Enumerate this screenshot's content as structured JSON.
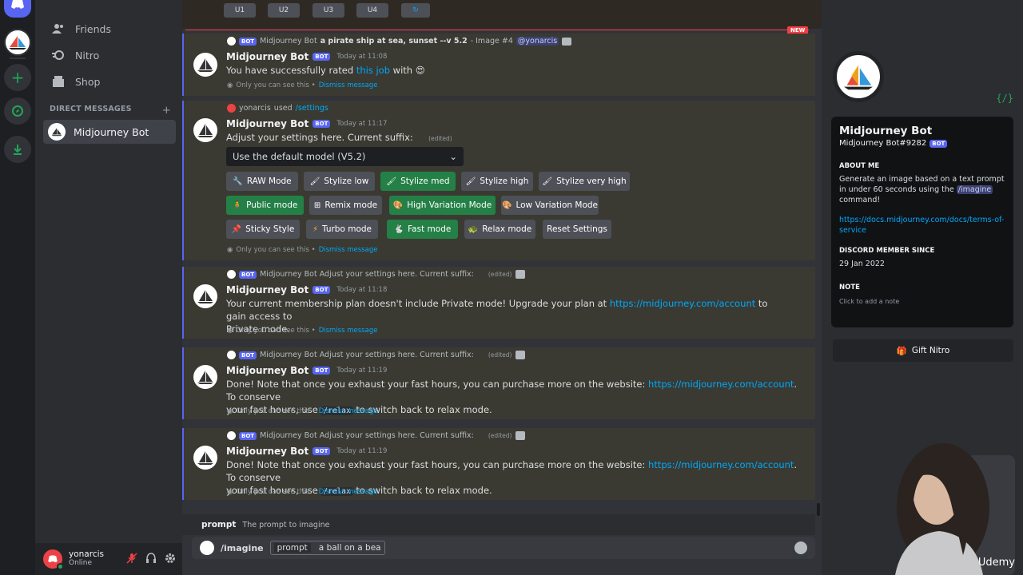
{
  "sidebar": {
    "nav": [
      {
        "label": "Friends",
        "icon": "friends-icon"
      },
      {
        "label": "Nitro",
        "icon": "nitro-icon"
      },
      {
        "label": "Shop",
        "icon": "shop-icon"
      }
    ],
    "dm_header": "DIRECT MESSAGES",
    "dm_items": [
      {
        "label": "Midjourney Bot"
      }
    ]
  },
  "user": {
    "name": "yonarcis",
    "status": "Online"
  },
  "top_buttons": [
    "U1",
    "U2",
    "U3",
    "U4"
  ],
  "new_badge": "NEW",
  "bot_tag": "BOT",
  "messages": [
    {
      "reply_prefix": "Midjourney Bot",
      "reply_bold": "a pirate ship at sea, sunset --v 5.2",
      "reply_suffix": "- Image #4",
      "reply_mention": "@yonarcis",
      "author": "Midjourney Bot",
      "time": "Today at 11:08",
      "text_a": "You have successfully rated",
      "text_link": "this job",
      "text_b": "with",
      "eph_text": "Only you can see this •",
      "eph_link": "Dismiss message"
    },
    {
      "reply_user": "yonarcis",
      "reply_used": "used",
      "reply_cmd": "/settings",
      "author": "Midjourney Bot",
      "time": "Today at 11:17",
      "text": "Adjust your settings here. Current suffix:",
      "edited": "(edited)",
      "select_value": "Use the default model (V5.2)",
      "buttons_row1": [
        "RAW Mode",
        "Stylize low",
        "Stylize med",
        "Stylize high",
        "Stylize very high"
      ],
      "buttons_row2": [
        "Public mode",
        "Remix mode",
        "High Variation Mode",
        "Low Variation Mode"
      ],
      "buttons_row3": [
        "Sticky Style",
        "Turbo mode",
        "Fast mode",
        "Relax mode",
        "Reset Settings"
      ],
      "eph_text": "Only you can see this •",
      "eph_link": "Dismiss message"
    },
    {
      "reply": "Midjourney Bot Adjust your settings here. Current suffix:",
      "edited": "(edited)",
      "author": "Midjourney Bot",
      "time": "Today at 11:18",
      "text_a": "Your current membership plan doesn't include Private mode! Upgrade your plan at",
      "link": "https://midjourney.com/account",
      "text_b": "to gain access to",
      "text_c": "Private mode.",
      "eph_text": "Only you can see this •",
      "eph_link": "Dismiss message"
    },
    {
      "reply": "Midjourney Bot Adjust your settings here. Current suffix:",
      "edited": "(edited)",
      "author": "Midjourney Bot",
      "time": "Today at 11:19",
      "text_a": "Done! Note that once you exhaust your fast hours, you can purchase more on the website:",
      "link": "https://midjourney.com/account",
      "text_b": ". To conserve",
      "text_c": "your fast hours, use",
      "code": "/relax",
      "text_d": "to switch back to relax mode.",
      "eph_text": "Only you can see this •",
      "eph_link": "Dismiss message"
    },
    {
      "reply": "Midjourney Bot Adjust your settings here. Current suffix:",
      "edited": "(edited)",
      "author": "Midjourney Bot",
      "time": "Today at 11:19",
      "text_a": "Done! Note that once you exhaust your fast hours, you can purchase more on the website:",
      "link": "https://midjourney.com/account",
      "text_b": ". To conserve",
      "text_c": "your fast hours, use",
      "code": "/relax",
      "text_d": "to switch back to relax mode.",
      "eph_text": "Only you can see this •",
      "eph_link": "Dismiss message"
    }
  ],
  "prompt_hint": {
    "key": "prompt",
    "desc": "The prompt to imagine"
  },
  "composer": {
    "command": "/imagine",
    "option": "prompt",
    "value": "a ball on a bea"
  },
  "profile": {
    "name": "Midjourney Bot",
    "tag": "Midjourney Bot#9282",
    "about_title": "ABOUT ME",
    "about_a": "Generate an image based on a text prompt in under 60 seconds using the",
    "about_cmd": "/imagine",
    "about_b": "command!",
    "terms_link": "https://docs.midjourney.com/docs/terms-of-service",
    "member_title": "DISCORD MEMBER SINCE",
    "member_date": "29 Jan 2022",
    "note_title": "NOTE",
    "note_placeholder": "Click to add a note",
    "gift": "Gift Nitro"
  },
  "watermark": "Udemy"
}
